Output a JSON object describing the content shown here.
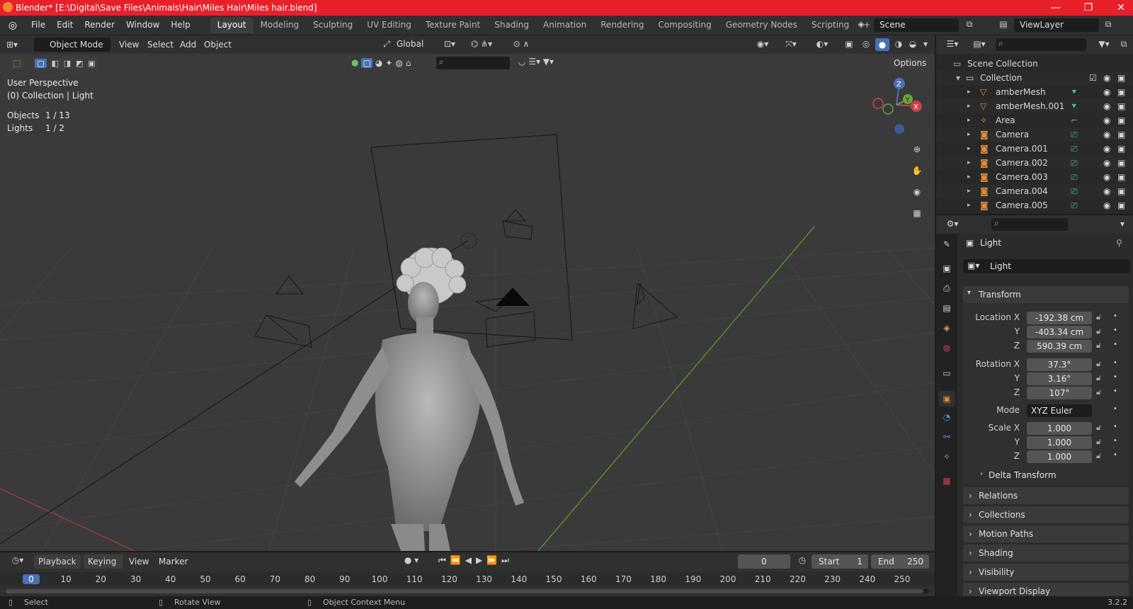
{
  "window": {
    "title": "Blender* [E:\\Digital\\Save Files\\Animals\\Hair\\Miles Hair\\Miles hair.blend]",
    "controls": [
      "—",
      "❐",
      "✕"
    ]
  },
  "menubar": {
    "menus": [
      "File",
      "Edit",
      "Render",
      "Window",
      "Help"
    ],
    "workspaces": [
      "Layout",
      "Modeling",
      "Sculpting",
      "UV Editing",
      "Texture Paint",
      "Shading",
      "Animation",
      "Rendering",
      "Compositing",
      "Geometry Nodes",
      "Scripting"
    ],
    "active_workspace": "Layout",
    "add_label": "+",
    "scene": "Scene",
    "view_layer": "ViewLayer"
  },
  "viewport": {
    "mode": "Object Mode",
    "menus": [
      "View",
      "Select",
      "Add",
      "Object"
    ],
    "transform_orientation": "Global",
    "options_label": "Options",
    "overlay_lines": [
      "User Perspective",
      "(0) Collection | Light"
    ],
    "stats": [
      {
        "label": "Objects",
        "value": "1 / 13"
      },
      {
        "label": "Lights",
        "value": "1 / 2"
      }
    ],
    "gizmo_axes": [
      "Z",
      "Y",
      "X"
    ]
  },
  "outliner": {
    "root": "Scene Collection",
    "collection": "Collection",
    "items": [
      {
        "name": "amberMesh",
        "type": "mesh"
      },
      {
        "name": "amberMesh.001",
        "type": "mesh"
      },
      {
        "name": "Area",
        "type": "light"
      },
      {
        "name": "Camera",
        "type": "camera"
      },
      {
        "name": "Camera.001",
        "type": "camera"
      },
      {
        "name": "Camera.002",
        "type": "camera"
      },
      {
        "name": "Camera.003",
        "type": "camera"
      },
      {
        "name": "Camera.004",
        "type": "camera"
      },
      {
        "name": "Camera.005",
        "type": "camera"
      }
    ]
  },
  "properties": {
    "object_name": "Light",
    "data_name": "Light",
    "transform_label": "Transform",
    "location_label": "Location X",
    "rotation_label": "Rotation X",
    "mode_label": "Mode",
    "scale_label": "Scale X",
    "axis_y": "Y",
    "axis_z": "Z",
    "location": [
      "-192.38 cm",
      "-403.34 cm",
      "590.39 cm"
    ],
    "rotation": [
      "37.3°",
      "3.16°",
      "107°"
    ],
    "mode": "XYZ Euler",
    "scale": [
      "1.000",
      "1.000",
      "1.000"
    ],
    "delta_transform": "Delta Transform",
    "panels": [
      "Relations",
      "Collections",
      "Motion Paths",
      "Shading",
      "Visibility",
      "Viewport Display"
    ]
  },
  "timeline": {
    "menus": [
      "Playback",
      "Keying",
      "View",
      "Marker"
    ],
    "current_frame": "0",
    "start_label": "Start",
    "start": "1",
    "end_label": "End",
    "end": "250",
    "ruler": [
      "0",
      "10",
      "20",
      "30",
      "40",
      "50",
      "60",
      "70",
      "80",
      "90",
      "100",
      "110",
      "120",
      "130",
      "140",
      "150",
      "160",
      "170",
      "180",
      "190",
      "200",
      "210",
      "220",
      "230",
      "240",
      "250"
    ]
  },
  "statusbar": {
    "hints": [
      "Select",
      "Rotate View",
      "Object Context Menu"
    ],
    "version": "3.2.2"
  },
  "colors": {
    "titlebar": "#e8202a",
    "accent": "#4772b3",
    "object_orange": "#e08a3c",
    "mesh_green": "#3fbfa5"
  }
}
